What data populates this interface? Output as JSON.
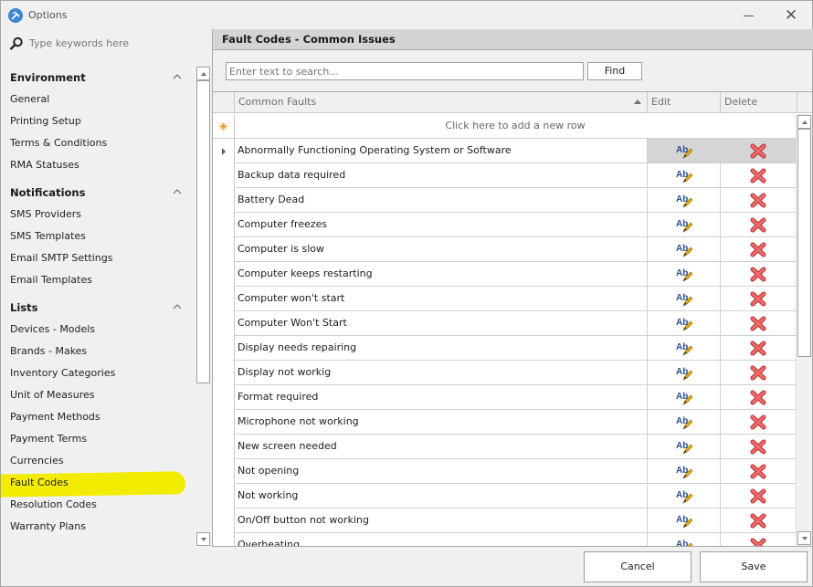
{
  "window": {
    "title": "Options",
    "app_icon": "tools-icon",
    "minimize_icon": "minimize-icon",
    "close_icon": "close-icon",
    "close_glyph": "✕"
  },
  "sidebar": {
    "search_placeholder": "Type keywords here",
    "groups": [
      {
        "label": "Environment",
        "items": [
          "General",
          "Printing Setup",
          "Terms & Conditions",
          "RMA Statuses"
        ]
      },
      {
        "label": "Notifications",
        "items": [
          "SMS Providers",
          "SMS Templates",
          "Email SMTP Settings",
          "Email Templates"
        ]
      },
      {
        "label": "Lists",
        "items": [
          "Devices - Models",
          "Brands - Makes",
          "Inventory Categories",
          "Unit of Measures",
          "Payment Methods",
          "Payment Terms",
          "Currencies",
          "Fault Codes",
          "Resolution Codes",
          "Warranty Plans"
        ]
      }
    ],
    "highlighted_item": "Fault Codes",
    "highlight_color": "#f2ec00"
  },
  "panel": {
    "title": "Fault Codes - Common Issues",
    "search_placeholder": "Enter text to search...",
    "find_label": "Find",
    "columns": {
      "name": "Common Faults",
      "edit": "Edit",
      "delete": "Delete"
    },
    "new_row_label": "Click here to add a new row",
    "rows": [
      "Abnormally Functioning Operating System or Software",
      "Backup data required",
      "Battery Dead",
      "Computer freezes",
      "Computer is slow",
      "Computer keeps restarting",
      "Computer won't start",
      "Computer Won't Start",
      "Display needs repairing",
      "Display not workig",
      "Format required",
      "Microphone not working",
      "New screen needed",
      "Not opening",
      "Not working",
      "On/Off button not working",
      "Overheating"
    ],
    "selected_row": 0
  },
  "footer": {
    "cancel_label": "Cancel",
    "save_label": "Save"
  },
  "colors": {
    "accent_blue": "#3f86cf",
    "delete_red": "#e05050",
    "new_row_star": "#f39a3a"
  }
}
